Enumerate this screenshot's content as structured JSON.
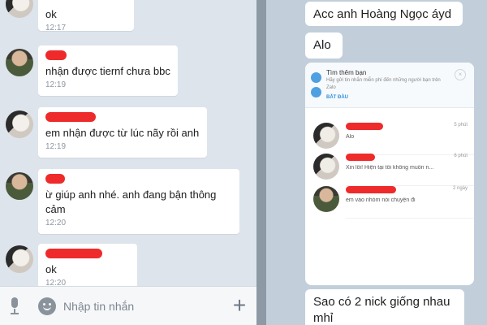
{
  "left_chat": {
    "messages": [
      {
        "avatar": "girl",
        "text": "ok",
        "time": "12:17"
      },
      {
        "avatar": "boy",
        "text": "nhận được tiernf chưa bbc",
        "time": "12:19"
      },
      {
        "avatar": "girl",
        "text": "em nhận được từ lúc nãy rồi anh",
        "time": "12:19"
      },
      {
        "avatar": "boy",
        "text": "ừ giúp anh nhé. anh đang bận thông cảm",
        "time": "12:20"
      },
      {
        "avatar": "girl",
        "text": "ok",
        "time": "12:20"
      }
    ],
    "input": {
      "placeholder": "Nhập tin nhắn"
    },
    "plus_label": "+"
  },
  "right_chat": {
    "messages": [
      {
        "text": "Acc anh Hoàng Ngọc áyd"
      },
      {
        "text": "Alo"
      },
      {
        "text": "Sao có 2 nick giống nhau mhỉ"
      }
    ],
    "screenshot": {
      "suggest_title": "Tìm thêm bạn",
      "suggest_desc": "Hãy gửi tin nhắn miễn phí đến những người bạn trên Zalo",
      "suggest_start": "BẮT ĐẦU",
      "close_label": "×",
      "conversations": [
        {
          "avatar": "girl",
          "preview": "Alo",
          "time": "5 phút"
        },
        {
          "avatar": "girl",
          "preview": "Xin lỗi! Hiện tại tôi không muốn n...",
          "time": "6 phút"
        },
        {
          "avatar": "boy",
          "preview": "em vào nhóm nói chuyện đi",
          "time": "2 ngày"
        }
      ]
    }
  },
  "colors": {
    "left_bg": "#dde4ec",
    "right_bg": "#c2cfdb",
    "redaction": "#ee2a2a",
    "accent": "#2f8fdc"
  }
}
